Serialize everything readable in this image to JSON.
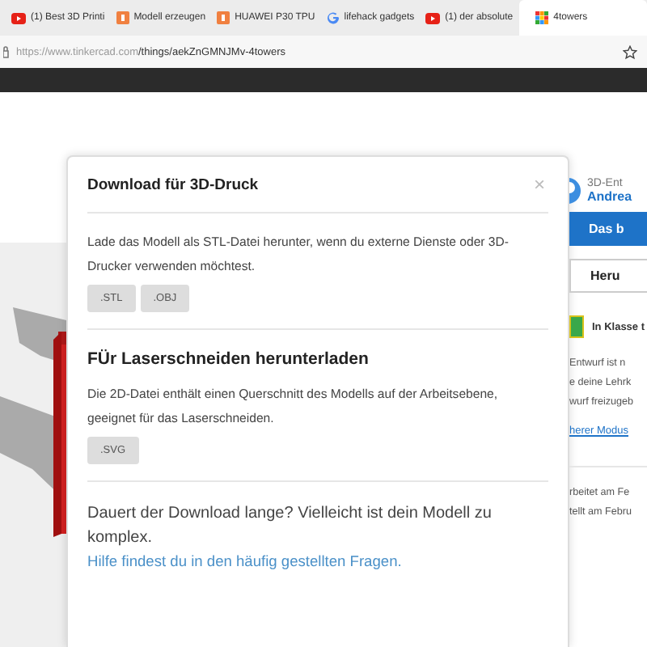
{
  "browser": {
    "tabs": [
      {
        "label": "(1) Best 3D Printi",
        "kind": "video",
        "selected": false
      },
      {
        "label": "Modell erzeugen",
        "kind": "app",
        "selected": false
      },
      {
        "label": "HUAWEI P30 TPU",
        "kind": "app",
        "selected": false
      },
      {
        "label": "lifehack gadgets",
        "kind": "search",
        "selected": false
      },
      {
        "label": "(1) der absolute",
        "kind": "video",
        "selected": false
      },
      {
        "label": "4towers",
        "kind": "grid",
        "selected": true
      }
    ],
    "url": {
      "host": "https://www.tinkercad.com",
      "path": "/things/aekZnGMNJMv-4towers"
    }
  },
  "dialog": {
    "title": "Download für 3D-Druck",
    "close": "×",
    "sections": [
      {
        "text": "Lade das Modell als STL-Datei herunter, wenn du externe Dienste oder 3D-Drucker verwenden möchtest.",
        "buttons": [
          ".STL",
          ".OBJ"
        ]
      },
      {
        "heading": "FÜr Laserschneiden herunterladen",
        "text": "Die 2D-Datei enthält einen Querschnitt des Modells auf der Arbeitsebene, geeignet für das Laserschneiden.",
        "buttons": [
          ".SVG"
        ]
      }
    ],
    "footer": {
      "text": "Dauert der Download lange? Vielleicht ist dein Modell zu komplex.",
      "link": "Hilfe findest du in den häufig gestellten Fragen."
    }
  },
  "side": {
    "role": "3D-Ent",
    "author": "Andrea",
    "primary_button": "Das b",
    "secondary_button": "Heru",
    "classroom": "In Klasse t",
    "notes": [
      "Entwurf ist n",
      "e deine Lehrk",
      "wurf freizugeb"
    ],
    "link": "herer Modus",
    "dates": [
      "rbeitet am Fe",
      "tellt am Febru"
    ]
  }
}
